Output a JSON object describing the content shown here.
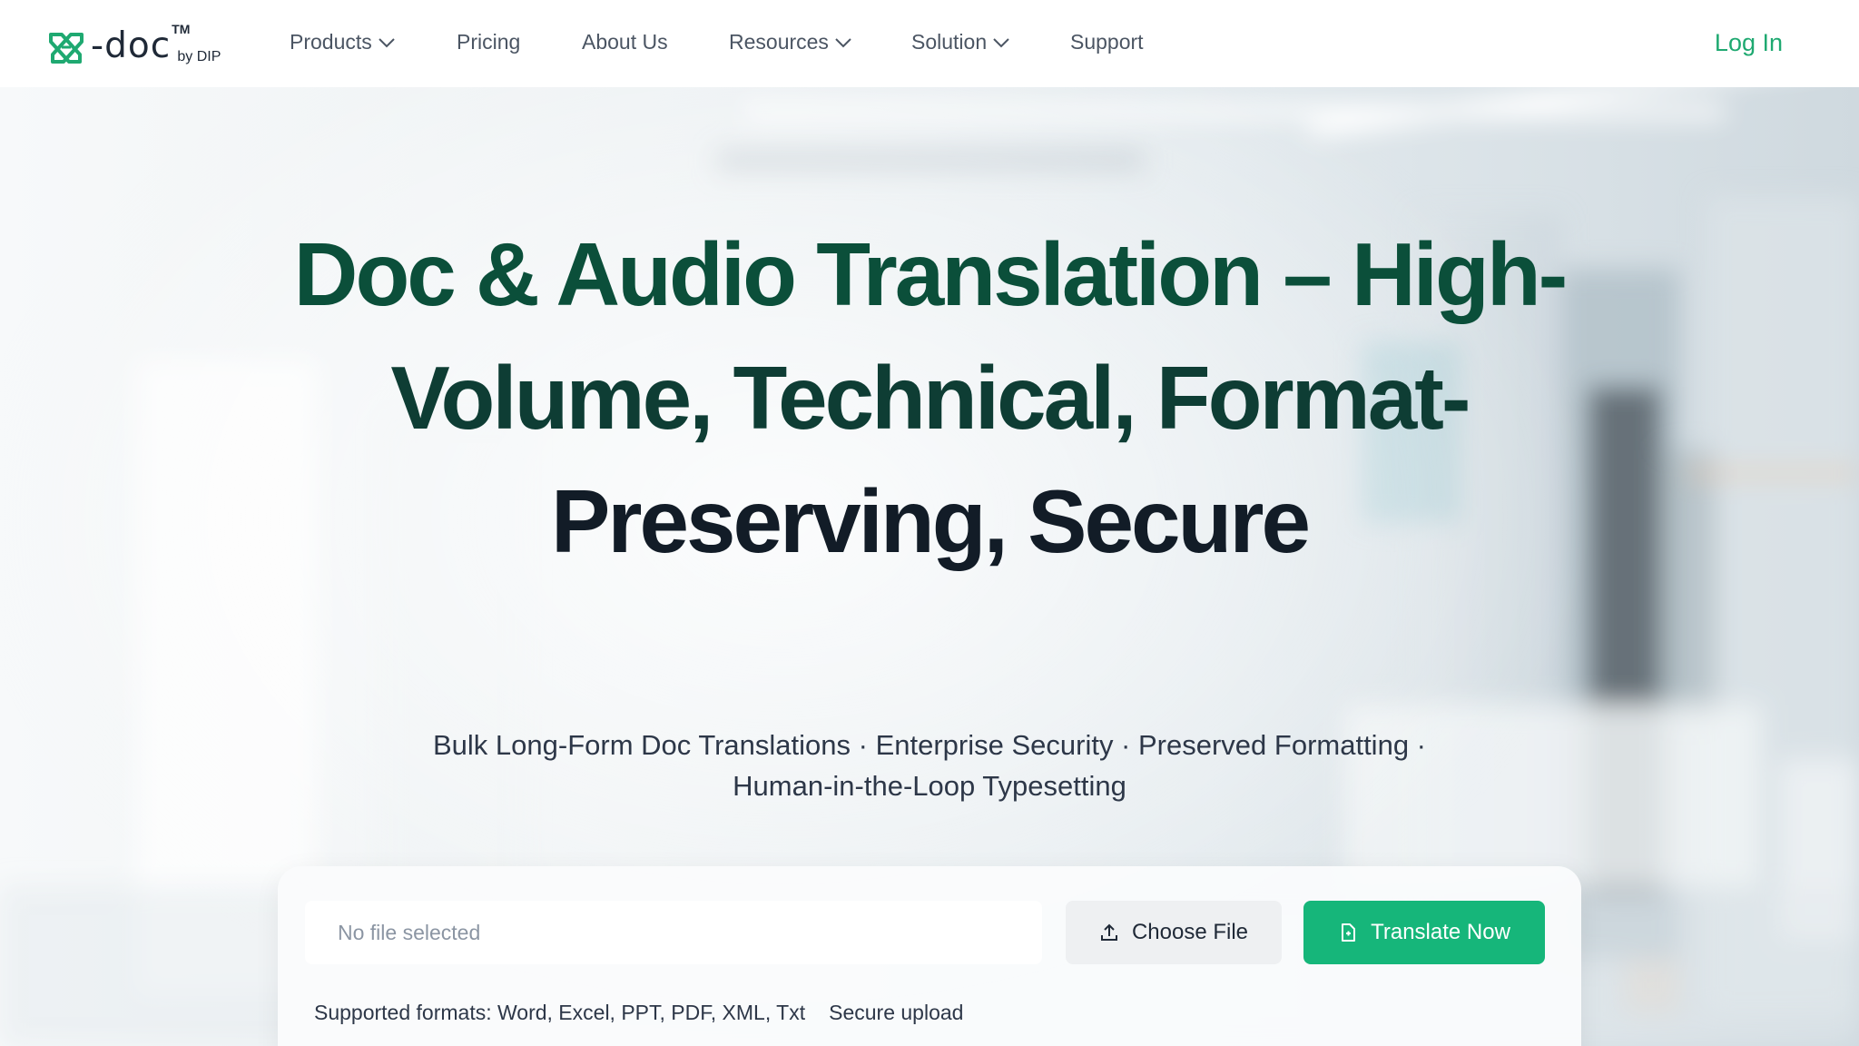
{
  "brand": {
    "name": "-doc",
    "trademark": "TM",
    "byline": "by DIP",
    "logo_icon": "dip-logo-mark-icon",
    "accent_color": "#1fa971"
  },
  "nav": {
    "items": [
      {
        "label": "Products",
        "has_dropdown": true
      },
      {
        "label": "Pricing",
        "has_dropdown": false
      },
      {
        "label": "About Us",
        "has_dropdown": false
      },
      {
        "label": "Resources",
        "has_dropdown": true
      },
      {
        "label": "Solution",
        "has_dropdown": true
      },
      {
        "label": "Support",
        "has_dropdown": false
      }
    ],
    "login_label": "Log In"
  },
  "hero": {
    "title_lines": [
      "Doc & Audio Translation – High-",
      "Volume, Technical, Format-",
      "Preserving, Secure"
    ],
    "subtitle_lines": [
      "Bulk Long-Form Doc Translations · Enterprise Security · Preserved Formatting ·",
      "Human-in-the-Loop Typesetting"
    ]
  },
  "upload": {
    "file_placeholder": "No file selected",
    "choose_label": "Choose File",
    "choose_icon": "upload-icon",
    "translate_label": "Translate Now",
    "translate_icon": "document-icon",
    "translate_color": "#16b67a",
    "supported_formats": "Supported formats: Word, Excel, PPT, PDF, XML, Txt",
    "secure_note": "Secure upload"
  }
}
